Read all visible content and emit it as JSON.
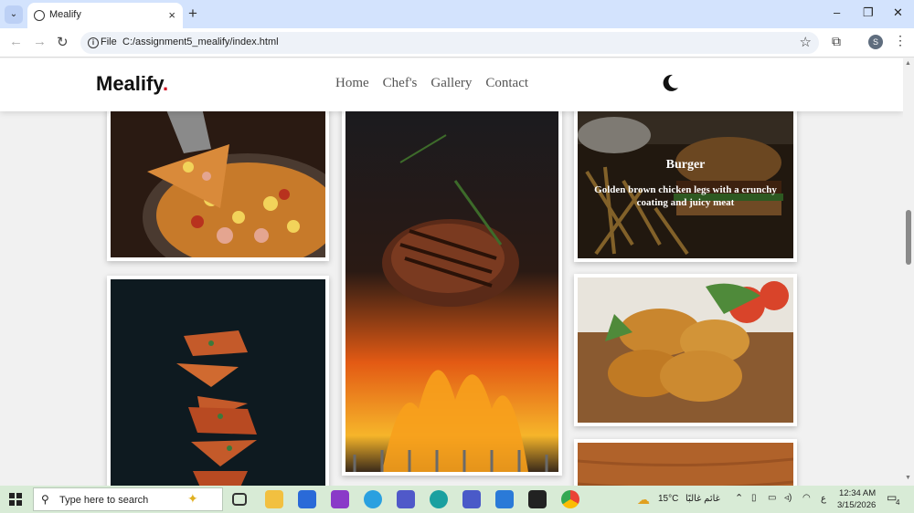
{
  "browser": {
    "tab_title": "Mealify",
    "tab_close": "×",
    "new_tab": "+",
    "file_label": "File",
    "url": "C:/assignment5_mealify/index.html",
    "window_controls": [
      "–",
      "❐",
      "✕"
    ],
    "profile_initial": "S"
  },
  "site": {
    "logo": "Mealify",
    "logo_dot": ".",
    "logo_dot_color": "#d0021b",
    "nav": [
      "Home",
      "Chef's",
      "Gallery",
      "Contact"
    ],
    "theme_toggle_icon": "moon-icon"
  },
  "gallery": {
    "images": [
      {
        "name": "pizza-slice-lift",
        "subject": "pizza"
      },
      {
        "name": "grilled-steak-flames",
        "subject": "steak"
      },
      {
        "name": "burger-fries",
        "subject": "burger"
      },
      {
        "name": "fried-chicken",
        "subject": "fried chicken"
      },
      {
        "name": "flying-pizza-slices",
        "subject": "pizza slices"
      },
      {
        "name": "wooden-board",
        "subject": "dish"
      }
    ],
    "hover_card": {
      "title": "Burger",
      "description": "Golden brown chicken legs with a crunchy coating and juicy meat"
    }
  },
  "taskbar": {
    "search_placeholder": "Type here to search",
    "weather_temp": "15°C",
    "weather_text": "غائم غالبًا",
    "lang": "ع",
    "time": "12:34 AM",
    "date": "3/15/2026",
    "notification_count": "4"
  }
}
